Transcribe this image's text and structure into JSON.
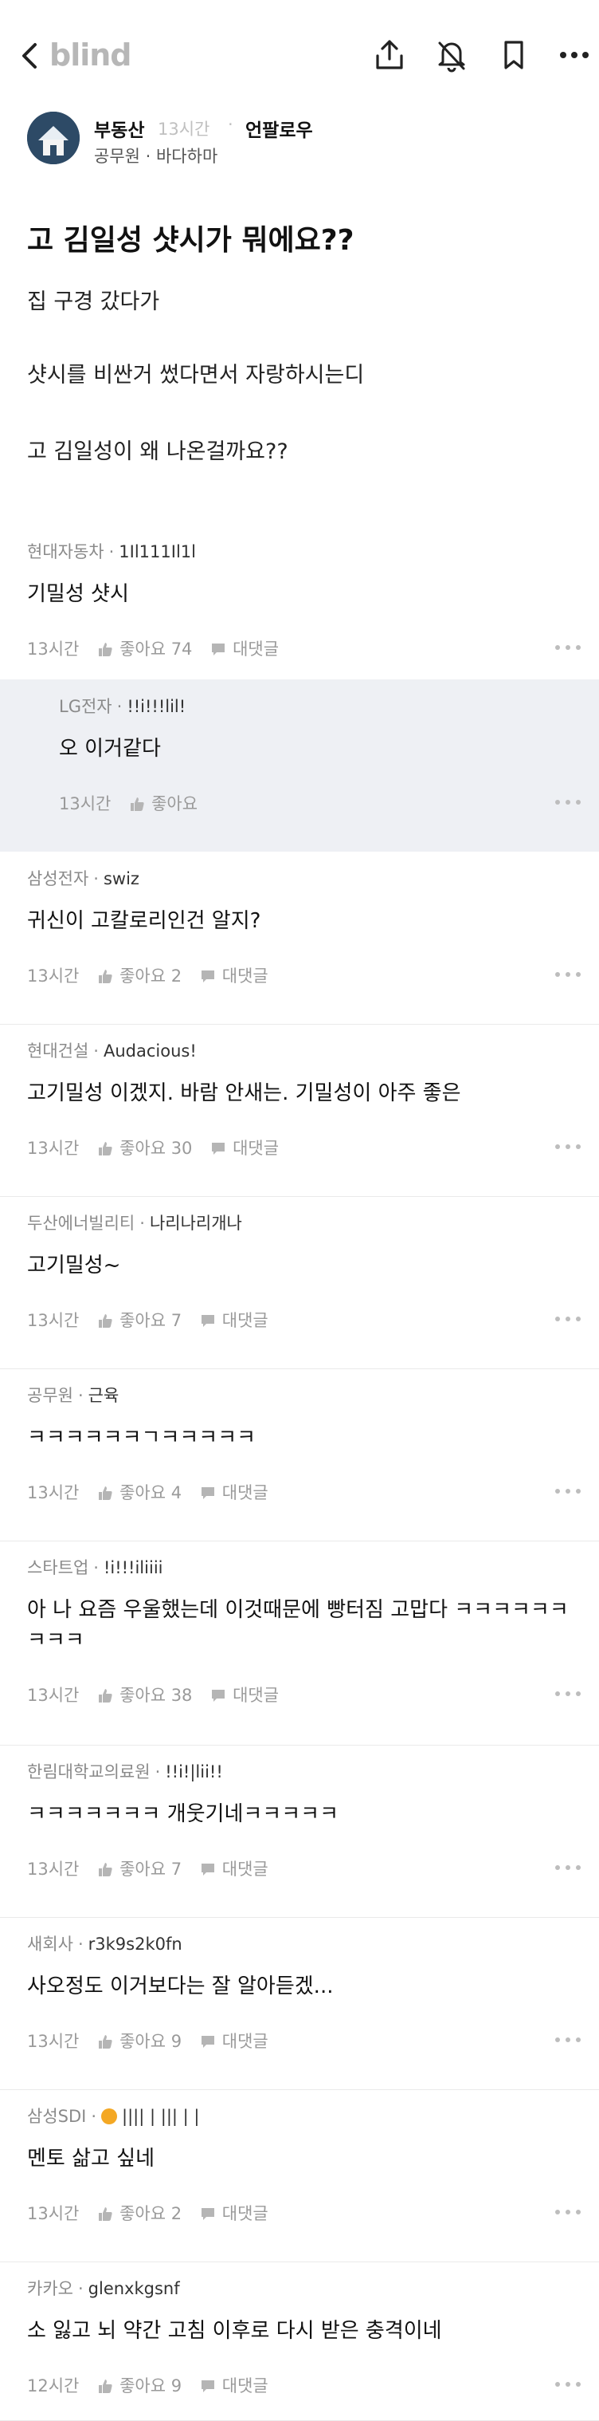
{
  "app": {
    "logo": "blind"
  },
  "post": {
    "author": "부동산",
    "time": "13시간",
    "follow_label": "언팔로우",
    "company": "공무원 · 바다하마",
    "title": "고 김일성 샷시가 뭐에요??",
    "body": [
      "집 구경 갔다가",
      "샷시를 비싼거 썼다면서 자랑하시는디",
      "고 김일성이 왜 나온걸까요??"
    ]
  },
  "comments": [
    {
      "company": "현대자동차",
      "nick": "1Il111Il1l",
      "text": "기밀성 샷시",
      "time": "13시간",
      "likes": "좋아요 74",
      "reply_label": "대댓글"
    },
    {
      "company": "LG전자",
      "nick": "!!i!!!lil!",
      "text": "오 이거같다",
      "time": "13시간",
      "likes": "좋아요",
      "reply_label": ""
    },
    {
      "company": "삼성전자",
      "nick": "swiz",
      "text": "귀신이 고칼로리인건 알지?",
      "time": "13시간",
      "likes": "좋아요 2",
      "reply_label": "대댓글"
    },
    {
      "company": "현대건설",
      "nick": "Audacious!",
      "text": "고기밀성 이겠지. 바람 안새는. 기밀성이 아주 좋은",
      "time": "13시간",
      "likes": "좋아요 30",
      "reply_label": "대댓글"
    },
    {
      "company": "두산에너빌리티",
      "nick": "나리나리개나",
      "text": "고기밀성~",
      "time": "13시간",
      "likes": "좋아요 7",
      "reply_label": "대댓글"
    },
    {
      "company": "공무원",
      "nick": "근육",
      "text": "ㅋㅋㅋㅋㅋㅋㄱㅋㅋㅋㅋㅋ",
      "time": "13시간",
      "likes": "좋아요 4",
      "reply_label": "대댓글"
    },
    {
      "company": "스타트업",
      "nick": "!i!!!iliiii",
      "text": "아 나 요즘 우울했는데 이것때문에 빵터짐 고맙다 ㅋㅋㅋㅋㅋㅋㅋㅋㅋ",
      "time": "13시간",
      "likes": "좋아요 38",
      "reply_label": "대댓글"
    },
    {
      "company": "한림대학교의료원",
      "nick": "!!i!|lii!!",
      "text": "ㅋㅋㅋㅋㅋㅋㅋ 개웃기네ㅋㅋㅋㅋㅋ",
      "time": "13시간",
      "likes": "좋아요 7",
      "reply_label": "대댓글"
    },
    {
      "company": "새회사",
      "nick": "r3k9s2k0fn",
      "text": "사오정도 이거보다는 잘 알아듣겠...",
      "time": "13시간",
      "likes": "좋아요 9",
      "reply_label": "대댓글"
    },
    {
      "company": "삼성SDI",
      "nick": "|||| | ||| | |",
      "text": "멘토 삶고 싶네",
      "time": "13시간",
      "likes": "좋아요 2",
      "reply_label": "대댓글"
    },
    {
      "company": "카카오",
      "nick": "glenxkgsnf",
      "text": "소 잃고 뇌 약간 고침 이후로 다시 받은 충격이네",
      "time": "12시간",
      "likes": "좋아요 9",
      "reply_label": "대댓글"
    }
  ]
}
